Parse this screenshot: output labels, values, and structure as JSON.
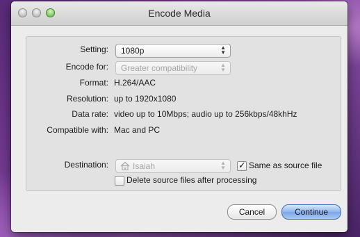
{
  "window": {
    "title": "Encode Media"
  },
  "form": {
    "setting": {
      "label": "Setting:",
      "value": "1080p"
    },
    "encode_for": {
      "label": "Encode for:",
      "value": "Greater compatibility"
    },
    "format": {
      "label": "Format:",
      "value": "H.264/AAC"
    },
    "resolution": {
      "label": "Resolution:",
      "value": "up to 1920x1080"
    },
    "data_rate": {
      "label": "Data rate:",
      "value": "video up to 10Mbps; audio up to 256kbps/48khHz"
    },
    "compatible_with": {
      "label": "Compatible with:",
      "value": "Mac and PC"
    },
    "destination": {
      "label": "Destination:",
      "value": "Isaiah",
      "icon": "home-icon"
    },
    "same_as_source": {
      "label": "Same as source file",
      "checked": true
    },
    "delete_source": {
      "label": "Delete source files after processing",
      "checked": false
    }
  },
  "buttons": {
    "cancel": "Cancel",
    "continue": "Continue"
  },
  "colors": {
    "accent": "#7aa6e8"
  }
}
